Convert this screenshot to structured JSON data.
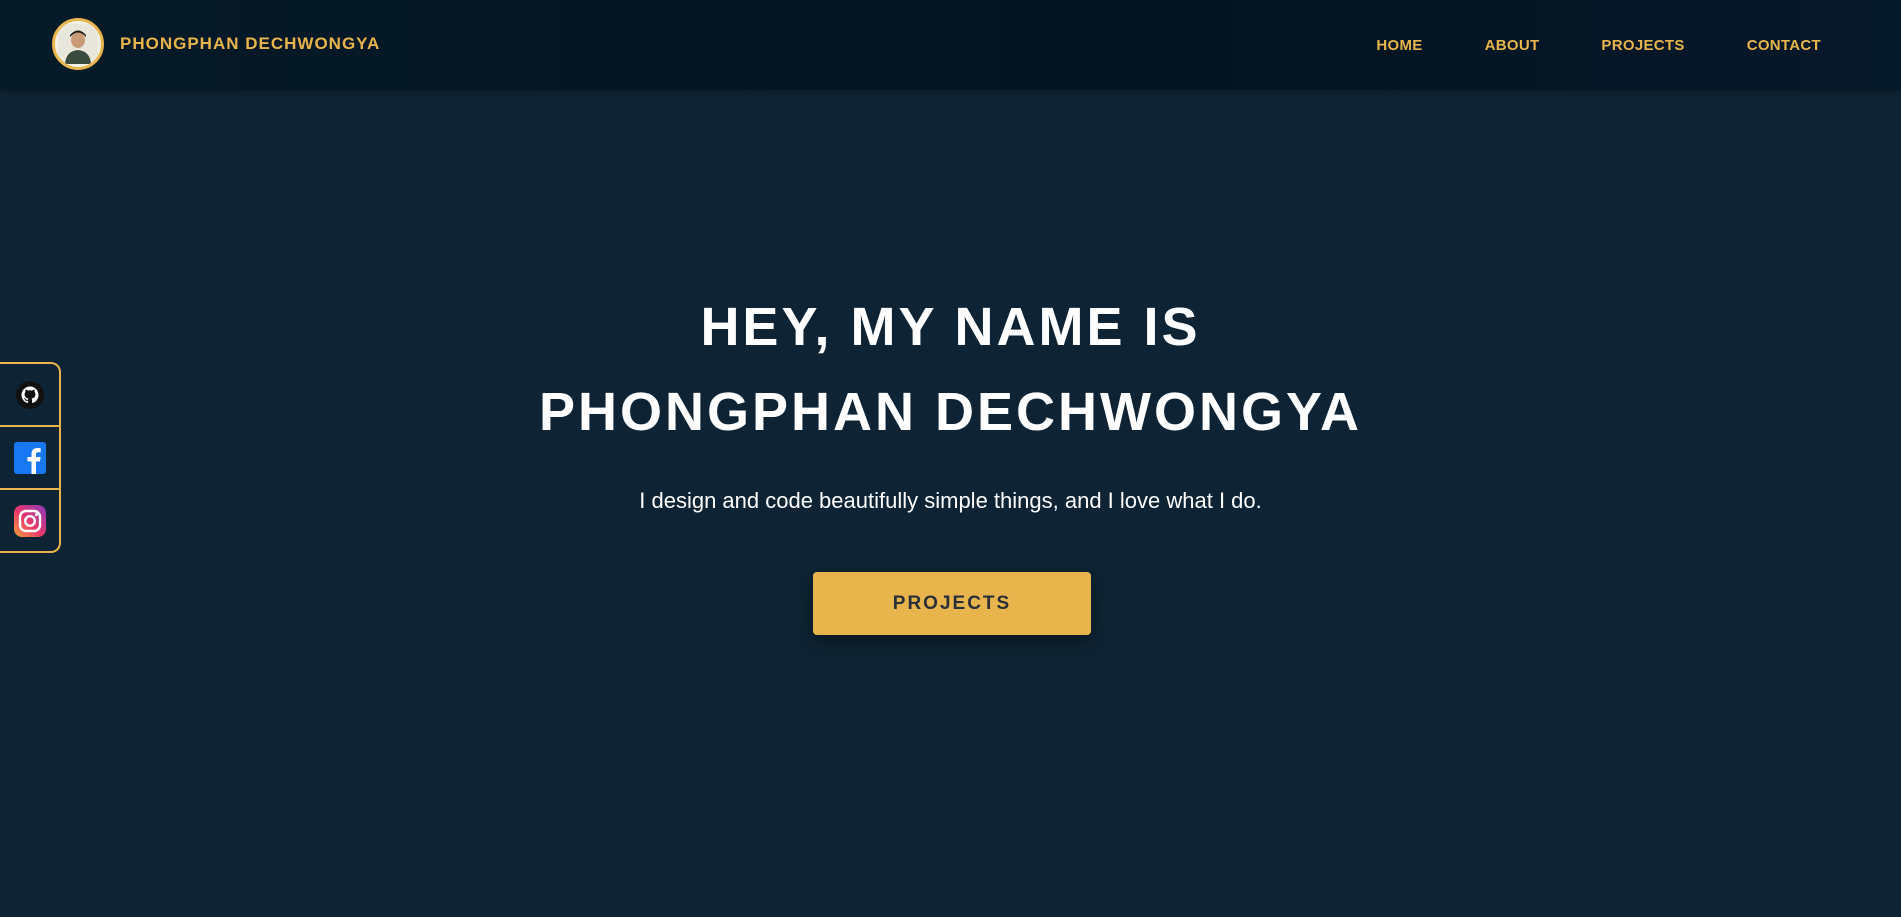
{
  "header": {
    "brand_name": "PHONGPHAN DECHWONGYA",
    "nav": [
      "HOME",
      "ABOUT",
      "PROJECTS",
      "CONTACT"
    ]
  },
  "hero": {
    "line1": "HEY, MY NAME IS",
    "line2": "PHONGPHAN DECHWONGYA",
    "subtitle": "I design and code beautifully simple things, and I love what I do.",
    "cta_label": "PROJECTS"
  },
  "social": [
    "github-icon",
    "facebook-icon",
    "instagram-icon"
  ],
  "colors": {
    "accent": "#e8b54d",
    "background": "#0e2333",
    "header_bg": "#03131f",
    "text": "#ffffff"
  }
}
